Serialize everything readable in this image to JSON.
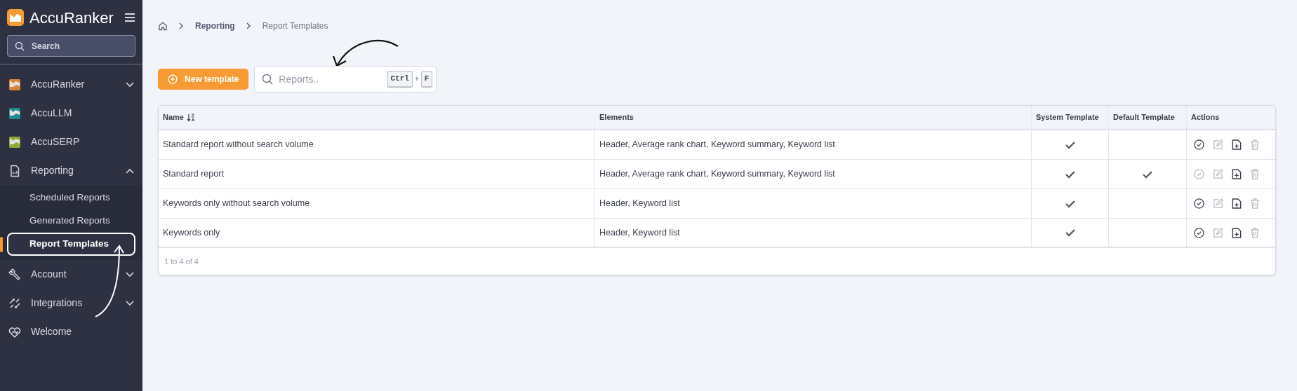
{
  "sidebar": {
    "brand": "AccuRanker",
    "search": {
      "placeholder": "Search"
    },
    "items": [
      {
        "label": "AccuRanker",
        "kind": "app",
        "color": "#d9843c",
        "expanded": false
      },
      {
        "label": "AccuLLM",
        "kind": "app",
        "color": "#1f8a94"
      },
      {
        "label": "AccuSERP",
        "kind": "app",
        "color": "#8fa83a"
      },
      {
        "label": "Reporting",
        "kind": "section",
        "expanded": true,
        "children": [
          {
            "label": "Scheduled Reports",
            "selected": false,
            "outlined": false
          },
          {
            "label": "Generated Reports",
            "selected": false,
            "outlined": false
          },
          {
            "label": "Report Templates",
            "selected": true,
            "outlined": true
          }
        ]
      },
      {
        "label": "Account",
        "kind": "section",
        "expanded": false
      },
      {
        "label": "Integrations",
        "kind": "section",
        "expanded": false
      },
      {
        "label": "Welcome",
        "kind": "section"
      }
    ]
  },
  "breadcrumb": [
    "Reporting",
    "Report Templates"
  ],
  "toolbar": {
    "new_button": "New template",
    "search": {
      "placeholder": "Reports..",
      "shortcut": [
        "Ctrl",
        "+",
        "F"
      ]
    }
  },
  "table": {
    "columns": [
      "Name",
      "Elements",
      "System Template",
      "Default Template",
      "Actions"
    ],
    "rows": [
      {
        "name": "Standard report without search volume",
        "elements": "Header, Average rank chart, Keyword summary, Keyword list",
        "system": true,
        "default": false,
        "set_default_disabled": false
      },
      {
        "name": "Standard report",
        "elements": "Header, Average rank chart, Keyword summary, Keyword list",
        "system": true,
        "default": true,
        "set_default_disabled": true
      },
      {
        "name": "Keywords only without search volume",
        "elements": "Header, Keyword list",
        "system": true,
        "default": false,
        "set_default_disabled": false
      },
      {
        "name": "Keywords only",
        "elements": "Header, Keyword list",
        "system": true,
        "default": false,
        "set_default_disabled": false
      }
    ],
    "footer": "1 to 4 of 4"
  }
}
